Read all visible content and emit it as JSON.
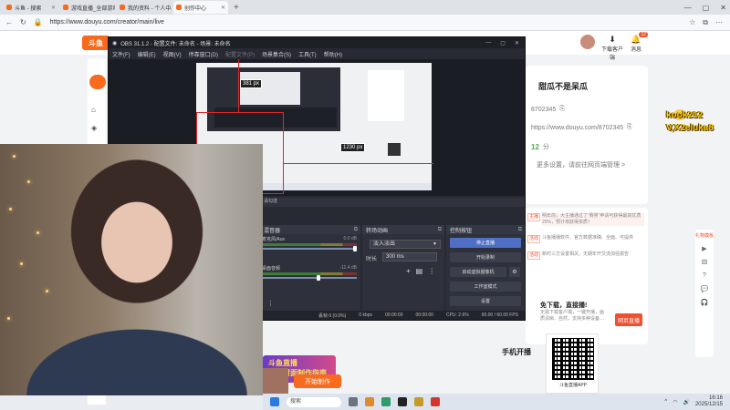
{
  "browser": {
    "tabs": [
      {
        "title": "斗鱼 - 搜索",
        "color": "#f86a1e",
        "active": false
      },
      {
        "title": "游戏直播_全部游戏直播_斗鱼直播",
        "color": "#f86a1e",
        "active": false
      },
      {
        "title": "我的资料 - 个人中心 - 斗鱼",
        "color": "#f86a1e",
        "active": false
      },
      {
        "title": "创作中心",
        "color": "#f86a1e",
        "active": true
      }
    ],
    "url": "https://www.douyu.com/creator/main/live"
  },
  "douyu": {
    "logo": "斗鱼",
    "header": {
      "download": "下载客户端",
      "message": "消息",
      "message_badge": "22"
    },
    "profile": {
      "name": "甜瓜不是呆瓜",
      "room_id": "8702345",
      "room_url": "https://www.douyu.com/8702345",
      "level": "12",
      "level_unit": "分",
      "manage_link": "更多设置，请前往网页端管理 >"
    },
    "notices": [
      {
        "tag": "主播",
        "text": "明年前，大主播通过了“赛男”申请可获得最高优质20%，预计将获得资质！"
      },
      {
        "tag": "活动",
        "text": "斗鱼播播软件、官方数据准确、全面、可提供"
      },
      {
        "tag": "活动",
        "text": "新时三方设置相关，无期年开交流加强报告"
      }
    ],
    "download_promo": {
      "title": "免下载，直接播!",
      "desc": "无需下载客户端，一键开播，画质清晰、自然，支持多种设备…",
      "button": "网页直播"
    },
    "mobile_title": "手机开播",
    "qr_label": "斗鱼直播APP",
    "overlay": {
      "line1": "kook212",
      "line2": "V,X2eluka8"
    },
    "promo_banner": {
      "line1": "斗鱼直播",
      "line2": "热门封面制作指南"
    },
    "start_button": "开始制作",
    "right_rail": {
      "red_label": "礼物模板"
    }
  },
  "obs": {
    "title": "OBS 31.1.2 - 配置文件: 未命名 - 场景: 未命名",
    "menu": [
      "文件(F)",
      "编辑(E)",
      "视图(V)",
      "停靠窗口(D)",
      "配置文件(P)",
      "场景集合(S)",
      "工具(T)",
      "帮助(H)"
    ],
    "measure_top": "381 px",
    "measure_right": "1230 px",
    "dock_header": "请勾选",
    "mixer": {
      "title": "混音器",
      "tracks": [
        {
          "name": "麦克风/Aux",
          "db": "0.0 dB",
          "knob_fraction": 1.0
        },
        {
          "name": "桌面音频",
          "db": "-11.4 dB",
          "knob_fraction": 0.62
        }
      ]
    },
    "transitions": {
      "title": "转场动画",
      "selected": "淡入淡出",
      "duration_label": "时长",
      "duration": "300 ms"
    },
    "controls": {
      "title": "控制按钮",
      "buttons": [
        "停止直播",
        "开始录制",
        "启动虚拟摄像机",
        "工作室模式",
        "设置"
      ]
    },
    "status": {
      "dropped": "丢帧 0 (0.0%)",
      "bitrate": "0 kbps",
      "live_time": "00:00:00",
      "rec_time": "00:00:00",
      "cpu": "CPU: 2.6%",
      "fps": "60.00 / 60.00 FPS"
    }
  },
  "taskbar": {
    "search": "搜索",
    "time": "16:16",
    "date": "2025/12/15"
  }
}
